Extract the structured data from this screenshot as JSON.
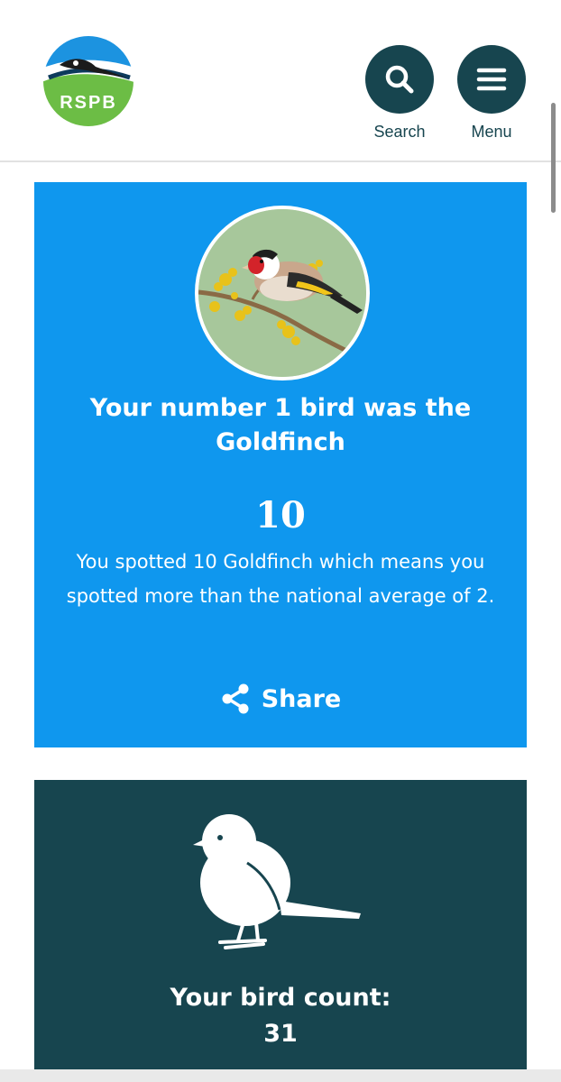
{
  "header": {
    "logo_text": "RSPB",
    "search_label": "Search",
    "menu_label": "Menu"
  },
  "top_bird": {
    "headline": "Your number 1 bird was the",
    "bird_name": "Goldfinch",
    "count": "10",
    "description": "You spotted 10 Goldfinch which means you spotted more than the national average of 2.",
    "share_label": "Share"
  },
  "bird_count": {
    "label": "Your bird count:",
    "value": "31"
  },
  "colors": {
    "brand_teal": "#17454f",
    "card_blue": "#0f97ee",
    "logo_green": "#6cbd45",
    "logo_blue": "#1c93e0"
  },
  "icons": {
    "search": "search-icon",
    "menu": "menu-icon",
    "share": "share-icon",
    "bird": "bird-icon"
  }
}
